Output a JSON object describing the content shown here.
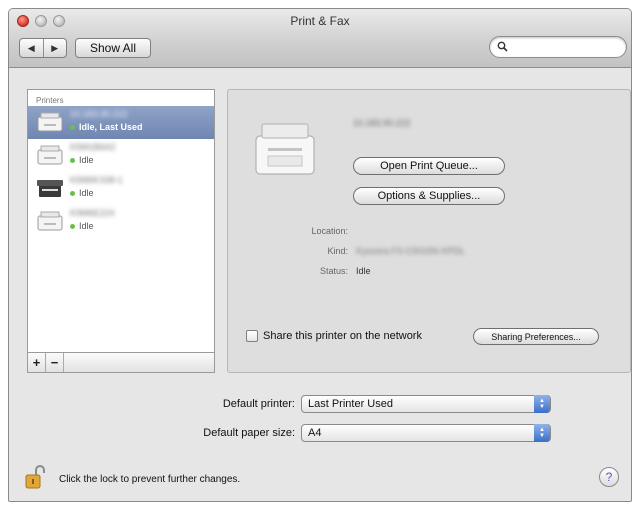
{
  "window": {
    "title": "Print & Fax",
    "show_all_label": "Show All",
    "back_glyph": "◀",
    "forward_glyph": "▶"
  },
  "printers": {
    "header": "Printers",
    "items": [
      {
        "name": "10.183.90.222",
        "status": "Idle, Last Used",
        "selected": true,
        "icon": "laser-printer-icon"
      },
      {
        "name": "K5M1B6A2",
        "status": "Idle",
        "selected": false,
        "icon": "laser-printer-icon"
      },
      {
        "name": "K5M6K338-1",
        "status": "Idle",
        "selected": false,
        "icon": "multifunction-printer-icon"
      },
      {
        "name": "K9M6E224",
        "status": "Idle",
        "selected": false,
        "icon": "laser-printer-icon"
      }
    ],
    "add_glyph": "+",
    "remove_glyph": "−"
  },
  "detail": {
    "printer_name": "10.183.90.222",
    "open_queue_label": "Open Print Queue...",
    "options_label": "Options & Supplies...",
    "location_label": "Location:",
    "location_value": "",
    "kind_label": "Kind:",
    "kind_value": "Kyocera FS-C5015N KPDL",
    "status_label": "Status:",
    "status_value": "Idle",
    "share_label": "Share this printer on the network",
    "share_checked": false,
    "sharing_prefs_label": "Sharing Preferences..."
  },
  "defaults": {
    "printer_label": "Default printer:",
    "printer_value": "Last Printer Used",
    "paper_label": "Default paper size:",
    "paper_value": "A4"
  },
  "footer": {
    "lock_text": "Click the lock to prevent further changes.",
    "help_glyph": "?"
  },
  "colors": {
    "selection": "#7489b4",
    "status_dot": "#6abf4b",
    "close_button": "#d8342a",
    "select_arrows": "#3b6fc6"
  }
}
